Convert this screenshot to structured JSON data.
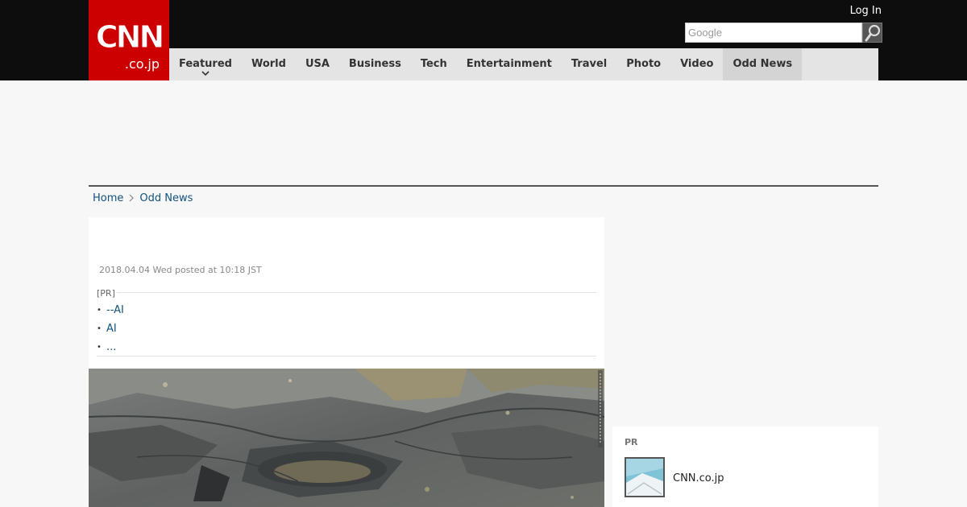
{
  "brand": {
    "logo_main": "CNN",
    "logo_sub": ".co.jp",
    "color": "#cc0000"
  },
  "header": {
    "login_label": "Log In",
    "search_placeholder": "Google",
    "search_icon": "search-icon"
  },
  "nav": {
    "items": [
      {
        "label": "Featured",
        "has_dropdown": true
      },
      {
        "label": "World"
      },
      {
        "label": "USA"
      },
      {
        "label": "Business"
      },
      {
        "label": "Tech"
      },
      {
        "label": "Entertainment"
      },
      {
        "label": "Travel"
      },
      {
        "label": "Photo"
      },
      {
        "label": "Video"
      },
      {
        "label": "Odd News",
        "active": true
      }
    ]
  },
  "breadcrumb": {
    "items": [
      "Home",
      "Odd News"
    ]
  },
  "article": {
    "dateline": "2018.04.04 Wed posted at 10:18 JST",
    "pr": {
      "label": "[PR]",
      "links": [
        "--AI",
        "AI",
        "..."
      ]
    }
  },
  "sidebar": {
    "pr_label": "PR",
    "item_source": "CNN.co.jp"
  },
  "colors": {
    "topbar": "#0d0d0d",
    "nav_bg": "#e4e4e4",
    "link": "#13527f"
  }
}
